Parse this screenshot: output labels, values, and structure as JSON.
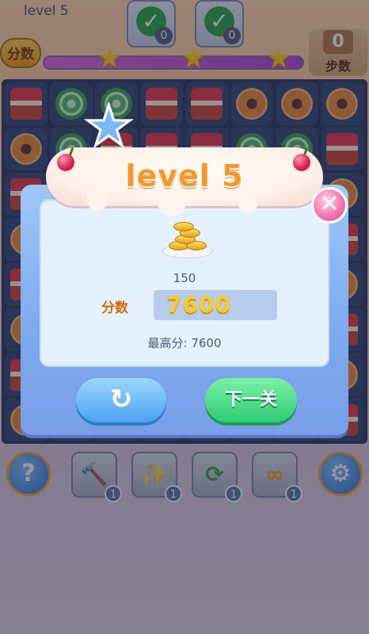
{
  "hud": {
    "level": "level 5",
    "goals": [
      {
        "count": "0",
        "icon": "check-icon"
      },
      {
        "count": "0",
        "icon": "check-icon"
      }
    ],
    "score_badge": "分数",
    "score_progress": 1.0,
    "steps_value": "0",
    "steps_label": "步数"
  },
  "tools": [
    {
      "icon": "hammer-icon",
      "count": "1"
    },
    {
      "icon": "wand-icon",
      "count": "1"
    },
    {
      "icon": "shuffle-icon",
      "count": "1"
    },
    {
      "icon": "infinity-icon",
      "count": "1"
    }
  ],
  "dialog": {
    "title": "level 5",
    "coins": "150",
    "score_label": "分数",
    "score_value": "7600",
    "best_score": "最高分: 7600",
    "next_label": "下一关",
    "retry_icon": "refresh-icon",
    "close_icon": "close-icon"
  },
  "colors": {
    "accent_orange": "#f39a2e",
    "dialog_blue": "#7da9ee",
    "next_green": "#2ecb75",
    "close_pink": "#f06aa8"
  }
}
